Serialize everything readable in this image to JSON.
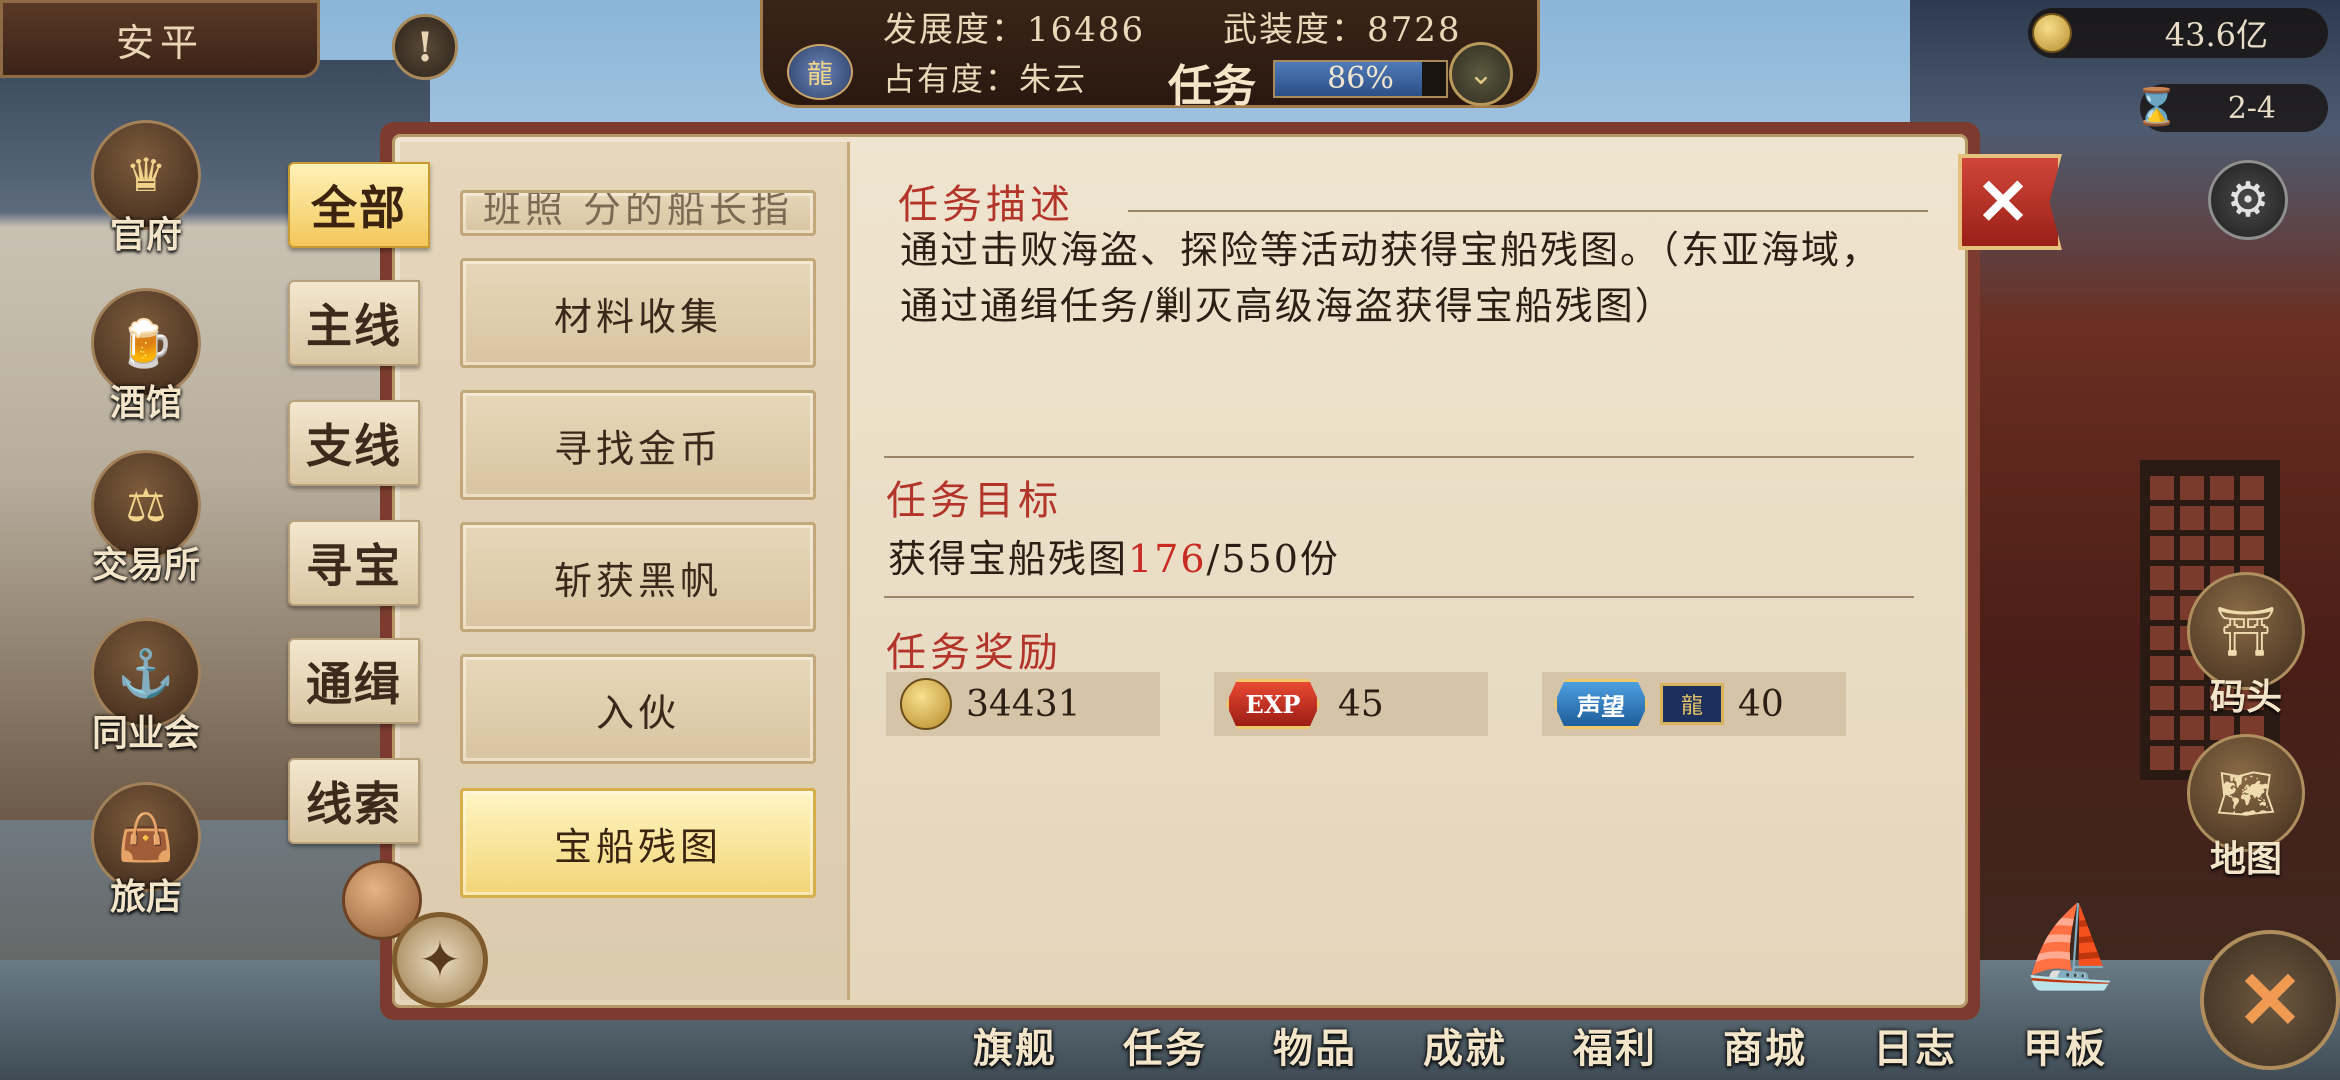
{
  "header": {
    "city": "安平",
    "development": "发展度：16486",
    "armament": "武装度：8728",
    "occupancy": "占有度：朱云",
    "task_title": "任务",
    "progress_text": "86%",
    "progress_fraction": 0.86
  },
  "resources": {
    "gold": "43.6亿",
    "time": "2-4"
  },
  "left_nav": [
    {
      "label": "官府",
      "icon": "crown-icon"
    },
    {
      "label": "酒馆",
      "icon": "beer-mug-icon"
    },
    {
      "label": "交易所",
      "icon": "scales-icon"
    },
    {
      "label": "同业会",
      "icon": "anchor-shield-icon"
    },
    {
      "label": "旅店",
      "icon": "bag-icon"
    }
  ],
  "right_nav": [
    {
      "label": "码头",
      "icon": "dock-icon"
    },
    {
      "label": "地图",
      "icon": "map-scroll-icon"
    }
  ],
  "bottom_nav": [
    "旗舰",
    "任务",
    "物品",
    "成就",
    "福利",
    "商城",
    "日志",
    "甲板"
  ],
  "categories": [
    "全部",
    "主线",
    "支线",
    "寻宝",
    "通缉",
    "线索"
  ],
  "active_category": "全部",
  "task_list": {
    "cut_item": "班照 分的船长指",
    "items": [
      "材料收集",
      "寻找金币",
      "斩获黑帆",
      "入伙",
      "宝船残图"
    ],
    "selected": "宝船残图"
  },
  "detail": {
    "description_title": "任务描述",
    "description": "通过击败海盗、探险等活动获得宝船残图。（东亚海域，通过通缉任务/剿灭高级海盗获得宝船残图）",
    "goal_title": "任务目标",
    "goal_prefix": "获得宝船残图",
    "goal_current": "176",
    "goal_suffix": "/550份",
    "reward_title": "任务奖励",
    "rewards": {
      "gold": "34431",
      "exp_badge": "EXP",
      "exp": "45",
      "reputation_badge": "声望",
      "reputation": "40"
    }
  },
  "colors": {
    "accent_red": "#b3352a",
    "highlight_red": "#c92b23",
    "panel_bg": "#efe4cf",
    "tab_active": "#f3c75a"
  }
}
